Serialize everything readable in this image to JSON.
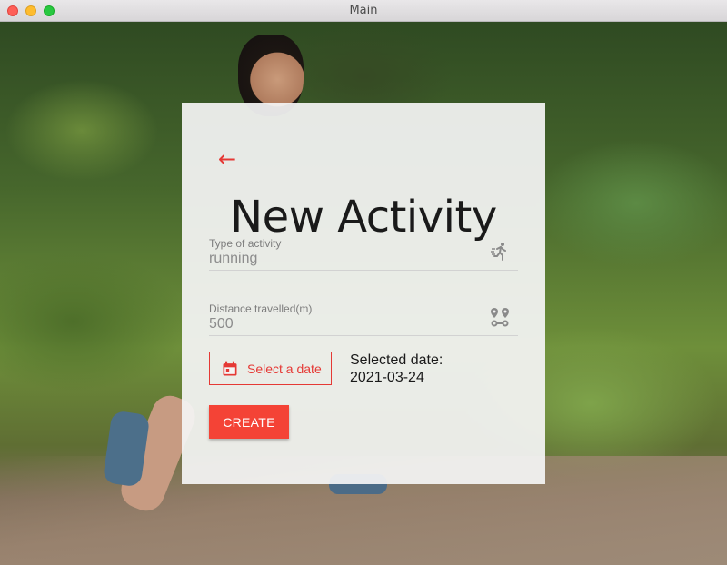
{
  "window": {
    "title": "Main"
  },
  "form": {
    "back_icon": "arrow-left-icon",
    "heading": "New Activity",
    "activity_type": {
      "label": "Type of activity",
      "value": "running",
      "icon": "running-person-icon"
    },
    "distance": {
      "label": "Distance travelled(m)",
      "value": "500",
      "icon": "route-icon"
    },
    "date_button": {
      "label": "Select a date",
      "icon": "calendar-icon"
    },
    "selected_date": {
      "label": "Selected date:",
      "value": "2021-03-24"
    },
    "create_button": {
      "label": "CREATE"
    }
  },
  "colors": {
    "accent": "#e53935",
    "button": "#f44336"
  }
}
